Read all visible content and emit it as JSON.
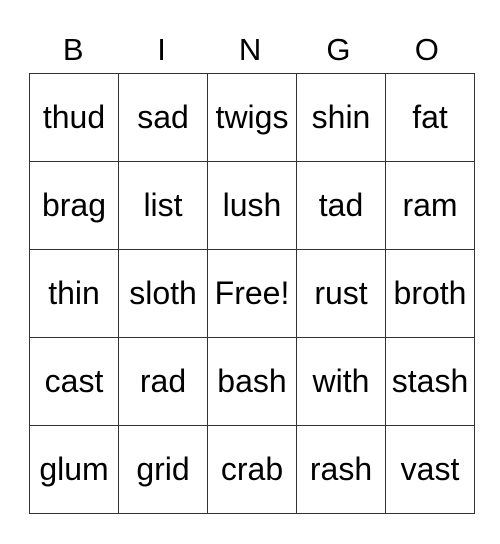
{
  "header": [
    "B",
    "I",
    "N",
    "G",
    "O"
  ],
  "rows": [
    [
      "thud",
      "sad",
      "twigs",
      "shin",
      "fat"
    ],
    [
      "brag",
      "list",
      "lush",
      "tad",
      "ram"
    ],
    [
      "thin",
      "sloth",
      "Free!",
      "rust",
      "broth"
    ],
    [
      "cast",
      "rad",
      "bash",
      "with",
      "stash"
    ],
    [
      "glum",
      "grid",
      "crab",
      "rash",
      "vast"
    ]
  ]
}
